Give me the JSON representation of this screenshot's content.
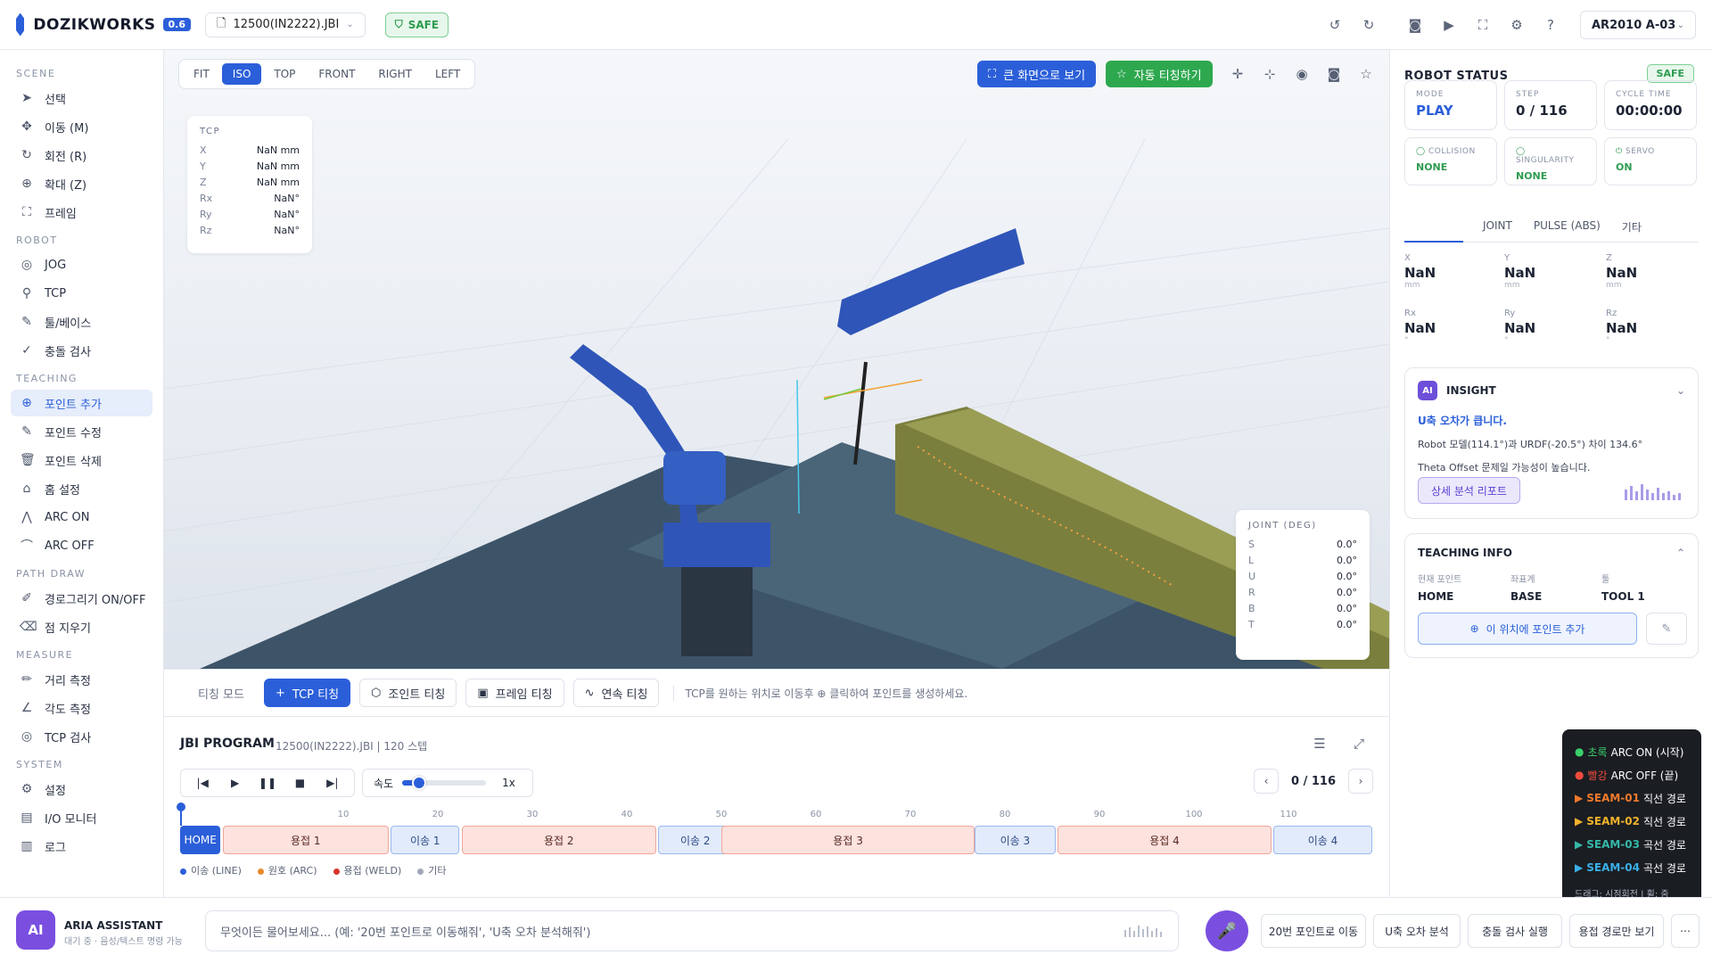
{
  "app": {
    "name": "DOZIKWORKS",
    "version": "0.6",
    "file": "12500(IN2222).JBI",
    "safe": "SAFE",
    "robot": "AR2010 A-03"
  },
  "sidebar": {
    "scene_title": "SCENE",
    "scene": [
      "선택",
      "이동 (M)",
      "회전 (R)",
      "확대 (Z)",
      "프레임"
    ],
    "robot_title": "ROBOT",
    "robot": [
      "JOG",
      "TCP",
      "툴/베이스",
      "충돌 검사"
    ],
    "teaching_title": "TEACHING",
    "teaching": [
      "포인트 추가",
      "포인트 수정",
      "포인트 삭제",
      "홈 설정",
      "ARC ON",
      "ARC OFF"
    ],
    "path_title": "PATH DRAW",
    "path": [
      "경로그리기 ON/OFF",
      "점 지우기"
    ],
    "measure_title": "MEASURE",
    "measure": [
      "거리 측정",
      "각도 측정",
      "TCP 검사"
    ],
    "system_title": "SYSTEM",
    "system": [
      "설정",
      "I/O 모니터",
      "로그"
    ]
  },
  "viewport": {
    "tabs": [
      "FIT",
      "ISO",
      "TOP",
      "FRONT",
      "RIGHT",
      "LEFT"
    ],
    "active_tab": "ISO",
    "fullscreen_label": "큰 화면으로 보기",
    "auto_teach_label": "자동 티칭하기",
    "tcp_title": "TCP",
    "tcp": [
      {
        "k": "X",
        "v": "NaN mm"
      },
      {
        "k": "Y",
        "v": "NaN mm"
      },
      {
        "k": "Z",
        "v": "NaN mm"
      },
      {
        "k": "Rx",
        "v": "NaN°"
      },
      {
        "k": "Ry",
        "v": "NaN°"
      },
      {
        "k": "Rz",
        "v": "NaN°"
      }
    ],
    "joint_title": "JOINT (DEG)",
    "joints": [
      {
        "k": "S",
        "v": "0.0°"
      },
      {
        "k": "L",
        "v": "0.0°"
      },
      {
        "k": "U",
        "v": "0.0°"
      },
      {
        "k": "R",
        "v": "0.0°"
      },
      {
        "k": "B",
        "v": "0.0°"
      },
      {
        "k": "T",
        "v": "0.0°"
      }
    ]
  },
  "teachbar": {
    "label": "티칭 모드",
    "tcp": "TCP 티칭",
    "joint": "조인트 티칭",
    "frame": "프레임 티칭",
    "cont": "연속 티칭",
    "hint": "TCP를 원하는 위치로 이동후 ⊕ 클릭하여 포인트를 생성하세요."
  },
  "jbi": {
    "title": "JBI PROGRAM",
    "sub": "12500(IN2222).JBI | 120 스텝",
    "speed_label": "속도",
    "speed_value": "1x",
    "speed_fraction": 0.2,
    "page": "0 / 116",
    "ticks": [
      "10",
      "20",
      "30",
      "40",
      "50",
      "60",
      "70",
      "80",
      "90",
      "100",
      "110"
    ],
    "segments": [
      "HOME",
      "용접 1",
      "이송 1",
      "용접 2",
      "이송 2",
      "용접 3",
      "이송 3",
      "용접 4",
      "이송 4"
    ],
    "legend": [
      "이송 (LINE)",
      "원호 (ARC)",
      "용접 (WELD)",
      "기타"
    ]
  },
  "status": {
    "title": "ROBOT STATUS",
    "safe": "SAFE",
    "mode_l": "MODE",
    "mode_v": "PLAY",
    "step_l": "STEP",
    "step_v": "0 / 116",
    "cycle_l": "CYCLE TIME",
    "cycle_v": "00:00:00",
    "col_l": "COLLISION",
    "col_v": "NONE",
    "sing_l": "SINGULARITY",
    "sing_v": "NONE",
    "servo_l": "SERVO",
    "servo_v": "ON",
    "tabs": [
      "JOINT",
      "PULSE (ABS)",
      "기타"
    ],
    "coords": [
      {
        "k": "X",
        "v": "NaN",
        "u": "mm"
      },
      {
        "k": "Y",
        "v": "NaN",
        "u": "mm"
      },
      {
        "k": "Z",
        "v": "NaN",
        "u": "mm"
      },
      {
        "k": "Rx",
        "v": "NaN",
        "u": "°"
      },
      {
        "k": "Ry",
        "v": "NaN",
        "u": "°"
      },
      {
        "k": "Rz",
        "v": "NaN",
        "u": "°"
      }
    ]
  },
  "insight": {
    "badge": "AI",
    "title": "INSIGHT",
    "headline": "U축 오차가 큽니다.",
    "line1": "Robot 모델(114.1°)과 URDF(-20.5°) 차이 134.6°",
    "line2": "Theta Offset 문제일 가능성이 높습니다.",
    "button": "상세 분석 리포트"
  },
  "teachinfo": {
    "title": "TEACHING INFO",
    "p_l": "현재 포인트",
    "p_v": "HOME",
    "c_l": "좌표계",
    "c_v": "BASE",
    "t_l": "툴",
    "t_v": "TOOL 1",
    "add": "이 위치에 포인트 추가"
  },
  "legend_pop": {
    "r1a": "초록",
    "r1b": "ARC ON (시작)",
    "r2a": "빨강",
    "r2b": "ARC OFF (끝)",
    "r3a": "SEAM-01",
    "r3b": "직선 경로",
    "r4a": "SEAM-02",
    "r4b": "직선 경로",
    "r5a": "SEAM-03",
    "r5b": "곡선 경로",
    "r6a": "SEAM-04",
    "r6b": "곡선 경로",
    "hint": "드래그: 시점회전 | 휠: 줌"
  },
  "assistant": {
    "avatar": "AI",
    "name": "ARIA ASSISTANT",
    "sub": "대기 중 · 음성/텍스트 명령 가능",
    "placeholder": "무엇이든 물어보세요... (예: '20번 포인트로 이동해줘', 'U축 오차 분석해줘')",
    "q1": "20번 포인트로 이동",
    "q2": "U축 오차 분석",
    "q3": "충돌 검사 실행",
    "q4": "용접 경로만 보기",
    "more": "⋯"
  }
}
